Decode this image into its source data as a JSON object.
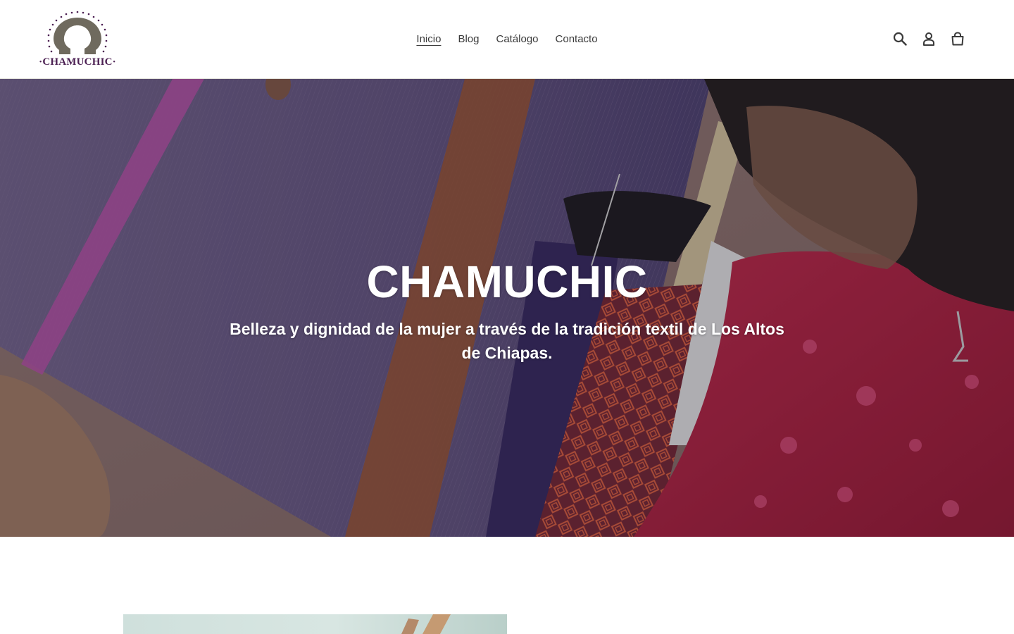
{
  "brand": {
    "name": "CHAMUCHIC",
    "logo_text": "·CHAMUCHIC·",
    "colors": {
      "purple": "#4b1f52",
      "taupe": "#6f6a5e"
    }
  },
  "nav": {
    "items": [
      {
        "label": "Inicio",
        "active": true
      },
      {
        "label": "Blog",
        "active": false
      },
      {
        "label": "Catálogo",
        "active": false
      },
      {
        "label": "Contacto",
        "active": false
      }
    ]
  },
  "header_icons": {
    "search": "search-icon",
    "account": "account-icon",
    "cart": "cart-icon"
  },
  "hero": {
    "title": "CHAMUCHIC",
    "subtitle": "Belleza y dignidad de la mujer a través de la tradición textil de Los Altos de Chiapas."
  }
}
